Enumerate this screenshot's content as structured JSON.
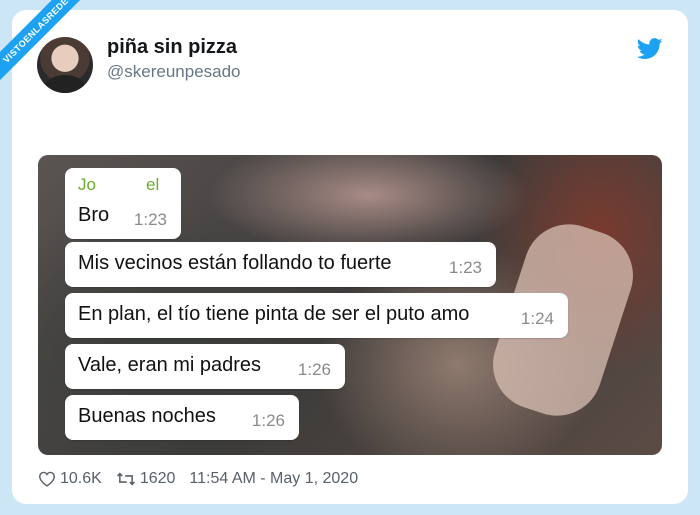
{
  "watermark": "VISTOENLASREDES",
  "tweet": {
    "display_name": "piña sin pizza",
    "handle": "@skereunpesado",
    "likes": "10.6K",
    "retweets": "1620",
    "timestamp": "11:54 AM - May 1, 2020"
  },
  "chat": {
    "sender_first": "Jo",
    "sender_second": "el",
    "messages": [
      {
        "text": "Bro",
        "time": "1:23"
      },
      {
        "text": "Mis vecinos están follando to fuerte",
        "time": "1:23"
      },
      {
        "text": "En plan, el tío tiene pinta de ser el puto amo",
        "time": "1:24"
      },
      {
        "text": "Vale, eran mi padres",
        "time": "1:26"
      },
      {
        "text": "Buenas noches",
        "time": "1:26"
      }
    ]
  },
  "colors": {
    "twitter_blue": "#1da1f2",
    "sender_green": "#6bab2d",
    "frame": "#cde6f6"
  },
  "icons": [
    "twitter-bird-icon",
    "heart-icon",
    "retweet-icon"
  ]
}
